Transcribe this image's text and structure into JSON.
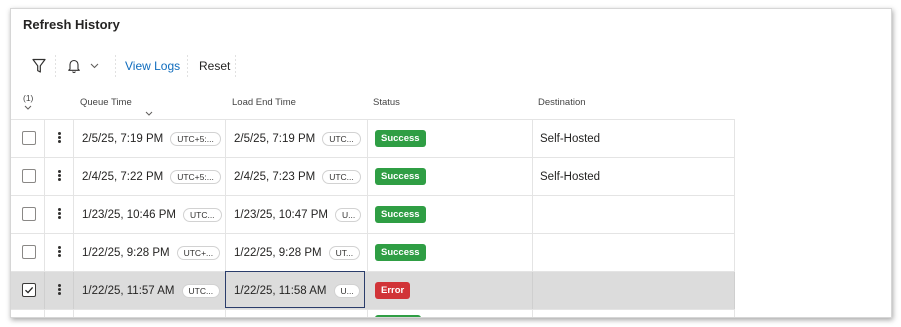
{
  "panel": {
    "title": "Refresh History"
  },
  "toolbar": {
    "filter_icon": "filter-icon",
    "alert_icon": "bell-icon",
    "view_logs_label": "View Logs",
    "reset_label": "Reset"
  },
  "header": {
    "selected_count": "(1)",
    "columns": [
      "Queue Time",
      "Load End Time",
      "Status",
      "Destination"
    ]
  },
  "rows": [
    {
      "checked": false,
      "queue_time": "2/5/25, 7:19 PM",
      "queue_tz": "UTC+5:...",
      "load_end_time": "2/5/25, 7:19 PM",
      "load_end_tz": "UTC...",
      "status": "Success",
      "destination": "Self-Hosted"
    },
    {
      "checked": false,
      "queue_time": "2/4/25, 7:22 PM",
      "queue_tz": "UTC+5:...",
      "load_end_time": "2/4/25, 7:23 PM",
      "load_end_tz": "UTC...",
      "status": "Success",
      "destination": "Self-Hosted"
    },
    {
      "checked": false,
      "queue_time": "1/23/25, 10:46 PM",
      "queue_tz": "UTC...",
      "load_end_time": "1/23/25, 10:47 PM",
      "load_end_tz": "U...",
      "status": "Success",
      "destination": ""
    },
    {
      "checked": false,
      "queue_time": "1/22/25, 9:28 PM",
      "queue_tz": "UTC+...",
      "load_end_time": "1/22/25, 9:28 PM",
      "load_end_tz": "UT...",
      "status": "Success",
      "destination": ""
    },
    {
      "checked": true,
      "queue_time": "1/22/25, 11:57 AM",
      "queue_tz": "UTC...",
      "load_end_time": "1/22/25, 11:58 AM",
      "load_end_tz": "U...",
      "status": "Error",
      "destination": ""
    }
  ],
  "colors": {
    "success": "#2f9e44",
    "error": "#d13438",
    "link": "#0f6cbd",
    "selected_row": "#dcdcdc"
  }
}
